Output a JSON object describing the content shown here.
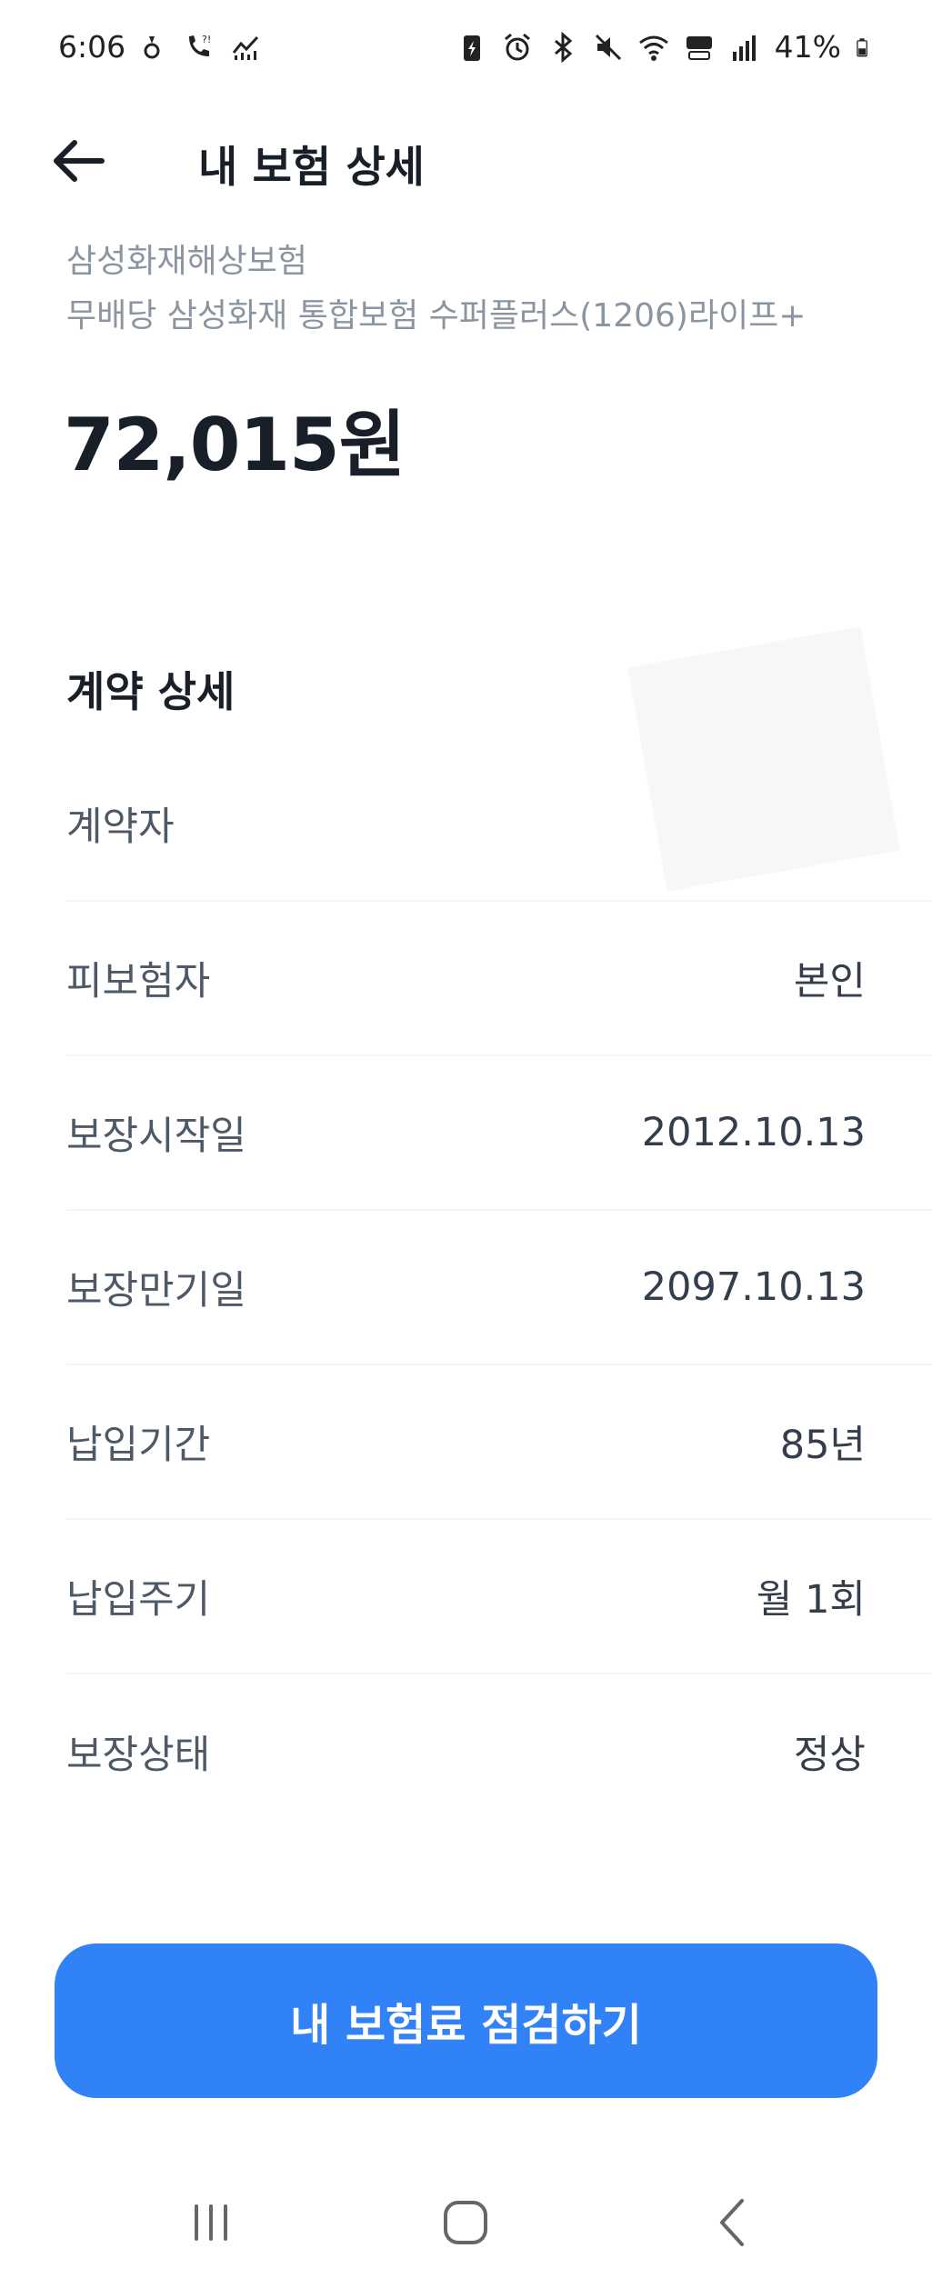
{
  "status_bar": {
    "time": "6:06",
    "battery": "41%"
  },
  "header": {
    "title": "내 보험 상세"
  },
  "policy": {
    "insurer": "삼성화재해상보험",
    "product": "무배당 삼성화재 통합보험 수퍼플러스(1206)라이프+",
    "amount": "72,015원"
  },
  "contract": {
    "section_title": "계약 상세",
    "rows": [
      {
        "label": "계약자",
        "value": ""
      },
      {
        "label": "피보험자",
        "value": "본인"
      },
      {
        "label": "보장시작일",
        "value": "2012.10.13"
      },
      {
        "label": "보장만기일",
        "value": "2097.10.13"
      },
      {
        "label": "납입기간",
        "value": "85년"
      },
      {
        "label": "납입주기",
        "value": "월 1회"
      },
      {
        "label": "보장상태",
        "value": "정상"
      }
    ]
  },
  "cta": {
    "label": "내 보험료 점검하기"
  },
  "colors": {
    "accent": "#3182f6",
    "title": "#191f28",
    "subtext": "#8b95a1"
  }
}
